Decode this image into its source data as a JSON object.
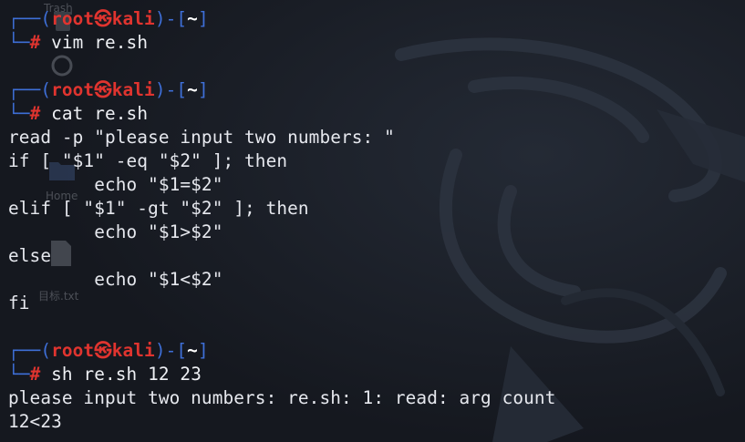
{
  "desktop": {
    "icons": [
      {
        "name": "trash-icon",
        "label": "Trash"
      },
      {
        "name": "settings-icon",
        "label": ""
      },
      {
        "name": "home-folder-icon",
        "label": "Home"
      },
      {
        "name": "file-icon",
        "label": "目标.txt"
      }
    ]
  },
  "prompt": {
    "bracket_open": "┌──(",
    "user": "root",
    "at_symbol": "㉿",
    "host": "kali",
    "sep": ")-[",
    "path": "~",
    "bracket_close": "]",
    "corner": "└─",
    "hash": "#"
  },
  "blocks": [
    {
      "command": "vim re.sh",
      "output": []
    },
    {
      "command": "cat re.sh",
      "output": [
        "read -p \"please input two numbers: \"",
        "if [ \"$1\" -eq \"$2\" ]; then",
        "        echo \"$1=$2\"",
        "elif [ \"$1\" -gt \"$2\" ]; then",
        "        echo \"$1>$2\"",
        "else",
        "        echo \"$1<$2\"",
        "fi"
      ]
    },
    {
      "command": "sh re.sh 12 23",
      "output": [
        "please input two numbers: re.sh: 1: read: arg count",
        "12<23"
      ]
    }
  ],
  "colors": {
    "background": "#171b23",
    "prompt_frame": "#3e6fd8",
    "prompt_user": "#e0342f",
    "text": "#e6e8ee"
  }
}
